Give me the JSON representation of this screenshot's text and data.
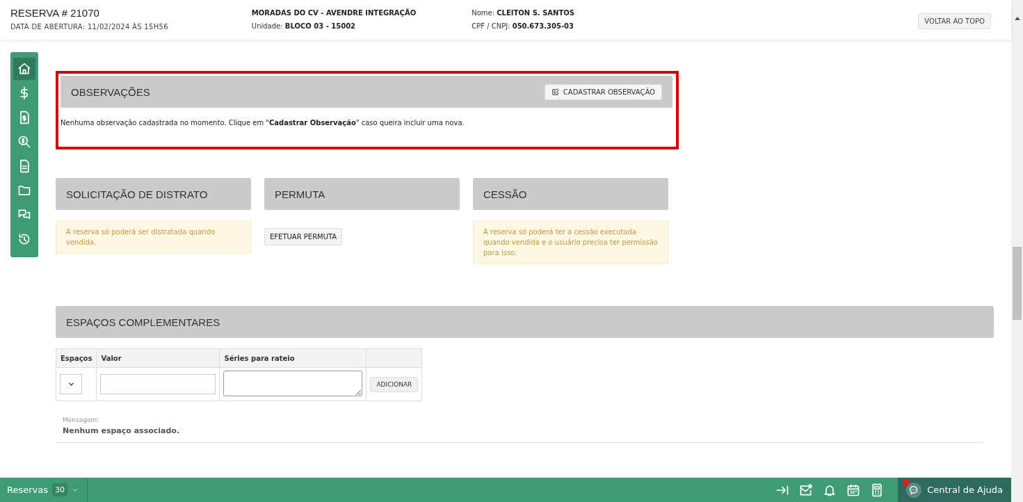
{
  "header": {
    "title": "RESERVA # 21070",
    "opened": "DATA DE ABERTURA: 11/02/2024 ÀS 15H56",
    "enterprise": "MORADAS DO CV - AVENDRE INTEGRAÇÃO",
    "unit_label": "Unidade:",
    "unit": "BLOCO 03 - 15002",
    "name_label": "Nome:",
    "name": "CLEITON S. SANTOS",
    "doc_label": "CPF / CNPJ:",
    "doc": "050.673.305-03",
    "top_button": "VOLTAR AO TOPO"
  },
  "sidebar": {
    "items": [
      {
        "selected": true
      },
      {
        "selected": false
      },
      {
        "selected": false
      },
      {
        "selected": false
      },
      {
        "selected": false
      },
      {
        "selected": false
      },
      {
        "selected": false
      },
      {
        "selected": false
      }
    ]
  },
  "observations": {
    "title": "OBSERVAÇÕES",
    "button": "CADASTRAR OBSERVAÇÃO",
    "message": "Nenhuma observação cadastrada no momento. Clique em \"**Cadastrar Observação**\" caso queira incluir uma nova.",
    "highlighted": true
  },
  "panels": [
    {
      "title": "SOLICITAÇÃO DE DISTRATO",
      "kind": "alert",
      "text": "A reserva só poderá ser distratada quando vendida."
    },
    {
      "title": "PERMUTA",
      "kind": "button",
      "text": "EFETUAR PERMUTA"
    },
    {
      "title": "CESSÃO",
      "kind": "alert",
      "text": "A reserva só poderá ter a cessão executada quando vendida e o usuário precisa ter permissão para isso."
    }
  ],
  "spaces": {
    "title": "ESPAÇOS COMPLEMENTARES",
    "columns": [
      "Espaços",
      "Valor",
      "Séries para rateio"
    ],
    "add_button": "ADICIONAR",
    "message_label": "Mensagem:",
    "message": "Nenhum espaço associado."
  },
  "bottom_bar": {
    "tab": "Reservas",
    "count": "30",
    "help": "Central de Ajuda",
    "help_notification": true
  }
}
